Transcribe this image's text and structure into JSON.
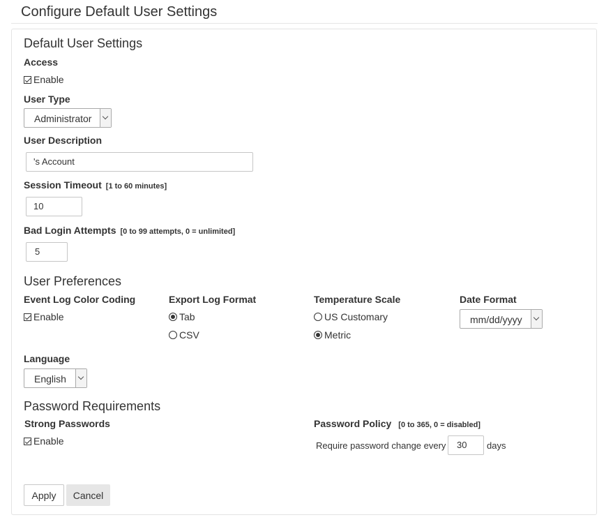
{
  "page": {
    "title": "Configure Default User Settings"
  },
  "default_user_settings": {
    "title": "Default User Settings",
    "access": {
      "label": "Access",
      "checkbox_label": "Enable",
      "checked": true
    },
    "user_type": {
      "label": "User Type",
      "value": "Administrator"
    },
    "user_description": {
      "label": "User Description",
      "value": "'s Account"
    },
    "session_timeout": {
      "label": "Session Timeout",
      "hint": "[1 to 60 minutes]",
      "value": "10"
    },
    "bad_login_attempts": {
      "label": "Bad Login Attempts",
      "hint": "[0 to 99 attempts, 0 = unlimited]",
      "value": "5"
    }
  },
  "user_preferences": {
    "title": "User Preferences",
    "event_log_color_coding": {
      "label": "Event Log Color Coding",
      "checkbox_label": "Enable",
      "checked": true
    },
    "export_log_format": {
      "label": "Export Log Format",
      "options": [
        {
          "label": "Tab",
          "selected": true
        },
        {
          "label": "CSV",
          "selected": false
        }
      ]
    },
    "temperature_scale": {
      "label": "Temperature Scale",
      "options": [
        {
          "label": "US Customary",
          "selected": false
        },
        {
          "label": "Metric",
          "selected": true
        }
      ]
    },
    "date_format": {
      "label": "Date Format",
      "value": "mm/dd/yyyy"
    },
    "language": {
      "label": "Language",
      "value": "English"
    }
  },
  "password_requirements": {
    "title": "Password Requirements",
    "strong_passwords": {
      "label": "Strong Passwords",
      "checkbox_label": "Enable",
      "checked": true
    },
    "password_policy": {
      "label": "Password Policy",
      "hint": "[0 to 365, 0 = disabled]",
      "prefix": "Require password change every",
      "value": "30",
      "suffix": "days"
    }
  },
  "actions": {
    "apply_label": "Apply",
    "cancel_label": "Cancel"
  },
  "icons": {
    "checkbox": "checkbox-checked-icon",
    "radio": "radio-icon",
    "dropdown": "chevron-down-icon"
  }
}
